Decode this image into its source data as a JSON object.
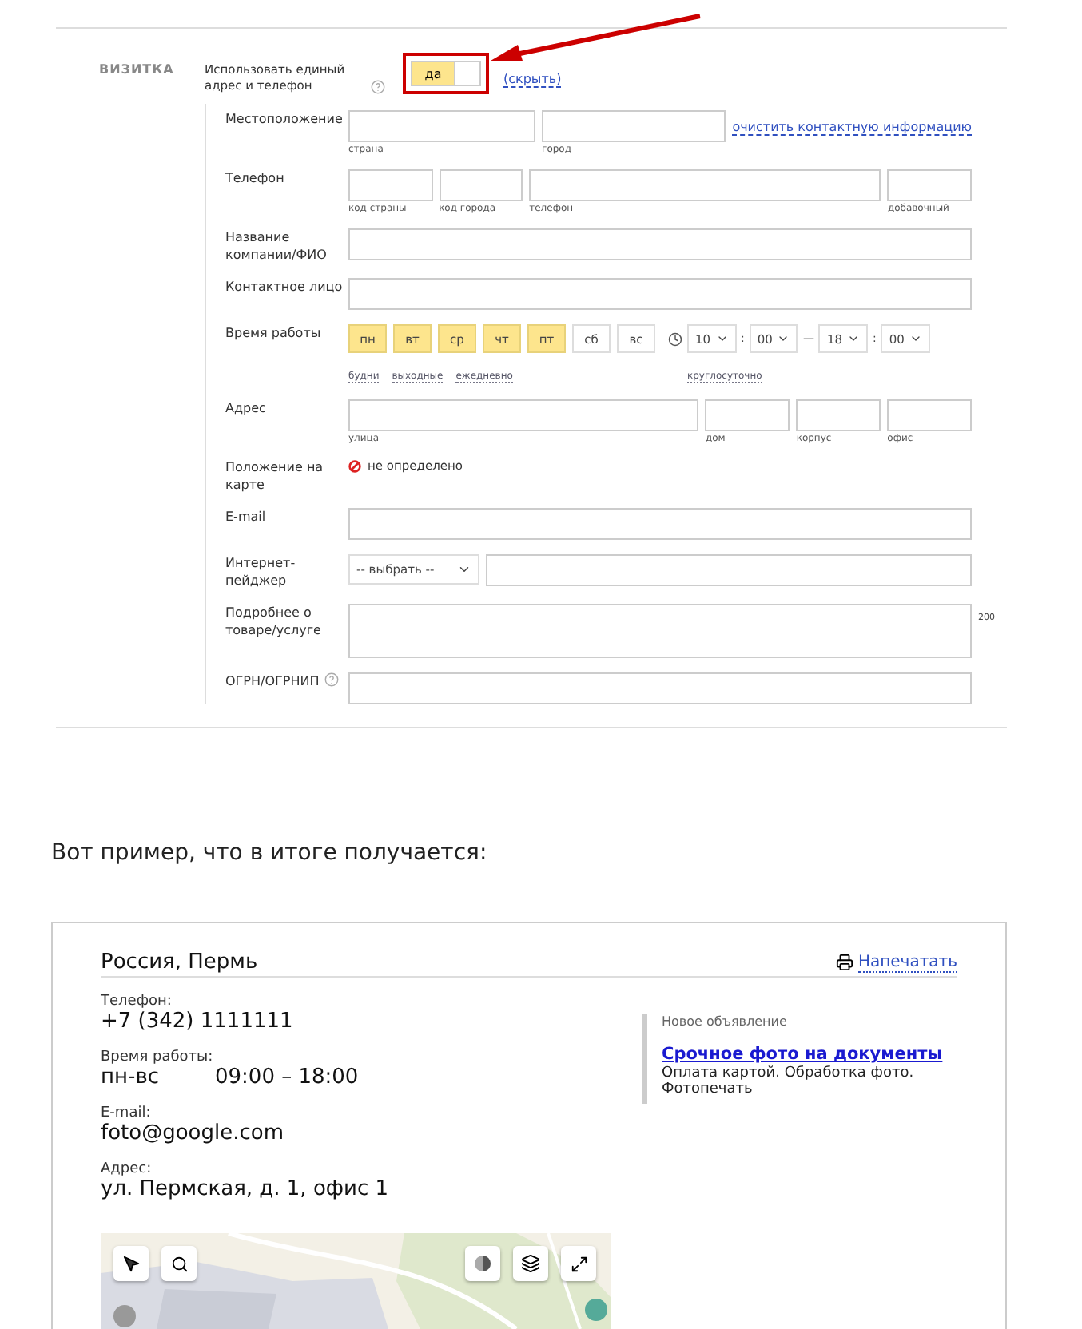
{
  "form": {
    "section_title": "ВИЗИТКА",
    "unified": {
      "label": "Использовать единый адрес и телефон",
      "on": true,
      "on_label": "да",
      "hide_link": "(скрыть)",
      "annotated": true
    },
    "rows": [
      {
        "kind": "location",
        "label": "Местоположение",
        "captions": [
          "страна",
          "город"
        ],
        "link": "очистить контактную информацию"
      },
      {
        "kind": "phone",
        "label": "Телефон",
        "captions": [
          "код страны",
          "код города",
          "телефон",
          "добавочный"
        ]
      },
      {
        "kind": "text",
        "label": "Название компании/ФИО"
      },
      {
        "kind": "text",
        "label": "Контактное лицо"
      },
      {
        "kind": "hours",
        "label": "Время работы",
        "days": [
          {
            "label": "пн",
            "selected": true
          },
          {
            "label": "вт",
            "selected": true
          },
          {
            "label": "ср",
            "selected": true
          },
          {
            "label": "чт",
            "selected": true
          },
          {
            "label": "пт",
            "selected": true
          },
          {
            "label": "сб",
            "selected": false
          },
          {
            "label": "вс",
            "selected": false
          }
        ],
        "shortcuts": [
          "будни",
          "выходные",
          "ежедневно"
        ],
        "time": [
          "10",
          "00",
          "18",
          "00"
        ],
        "colon": ":",
        "dash": "—",
        "around_clock": "круглосуточно"
      },
      {
        "kind": "address",
        "label": "Адрес",
        "captions": [
          "улица",
          "дом",
          "корпус",
          "офис"
        ]
      },
      {
        "kind": "map_status",
        "label": "Положение на карте",
        "status": "не определено"
      },
      {
        "kind": "text",
        "label": "E-mail"
      },
      {
        "kind": "messenger",
        "label": "Интернет-пейджер",
        "select": "-- выбрать --"
      },
      {
        "kind": "textarea",
        "label": "Подробнее о товаре/услуге",
        "counter": "200"
      },
      {
        "kind": "text",
        "label": "ОГРН/ОГРНИП",
        "help": true
      }
    ]
  },
  "caption": "Вот пример, что в итоге получается:",
  "card": {
    "title": "Россия, Пермь",
    "print": "Напечатать",
    "phone": {
      "label": "Телефон:",
      "value": "+7 (342) 1111111"
    },
    "hours": {
      "label": "Время работы:",
      "days": "пн-вс",
      "time": "09:00 – 18:00"
    },
    "email": {
      "label": "E-mail:",
      "value": "foto@google.com"
    },
    "address": {
      "label": "Адрес:",
      "value": "ул. Пермская, д. 1, офис 1"
    },
    "ad": {
      "caption": "Новое объявление",
      "title": "Срочное фото на документы",
      "text": "Оплата картой. Обработка фото. Фотопечать"
    }
  }
}
